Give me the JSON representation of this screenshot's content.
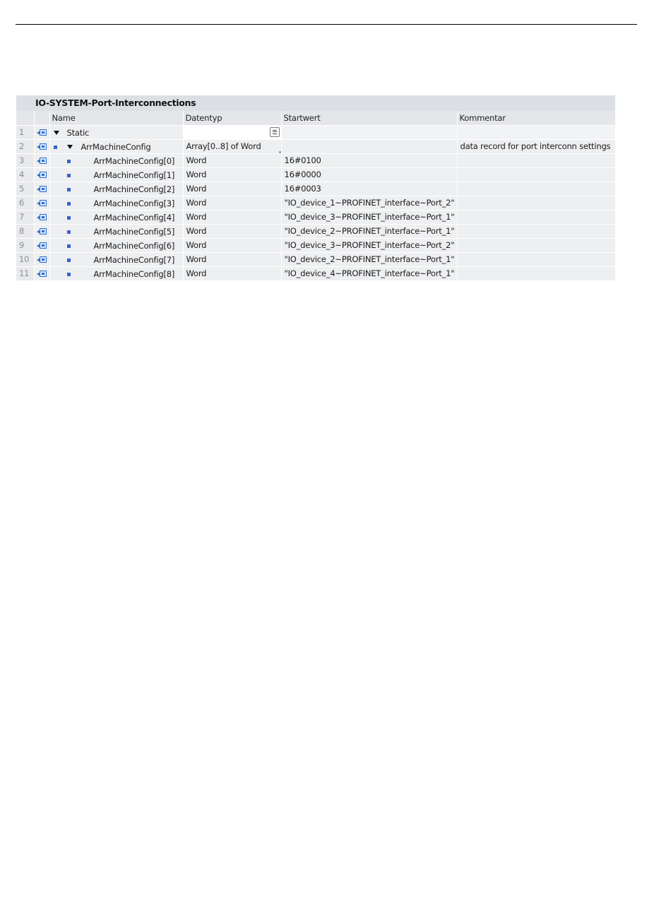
{
  "block": {
    "title": "IO-SYSTEM-Port-Interconnections"
  },
  "columns": {
    "name": "Name",
    "datatype": "Datentyp",
    "start": "Startwert",
    "comment": "Kommentar"
  },
  "rows": [
    {
      "num": "1",
      "name": "Static",
      "datatype": "",
      "start": "",
      "comment": ""
    },
    {
      "num": "2",
      "name": "ArrMachineConfig",
      "datatype": "Array[0..8] of Word",
      "start": "",
      "comment": "data record for port interconn settings"
    },
    {
      "num": "3",
      "name": "ArrMachineConfig[0]",
      "datatype": "Word",
      "start": "16#0100",
      "comment": ""
    },
    {
      "num": "4",
      "name": "ArrMachineConfig[1]",
      "datatype": "Word",
      "start": "16#0000",
      "comment": ""
    },
    {
      "num": "5",
      "name": "ArrMachineConfig[2]",
      "datatype": "Word",
      "start": "16#0003",
      "comment": ""
    },
    {
      "num": "6",
      "name": "ArrMachineConfig[3]",
      "datatype": "Word",
      "start": "\"IO_device_1~PROFINET_interface~Port_2\"",
      "comment": ""
    },
    {
      "num": "7",
      "name": "ArrMachineConfig[4]",
      "datatype": "Word",
      "start": "\"IO_device_3~PROFINET_interface~Port_1\"",
      "comment": ""
    },
    {
      "num": "8",
      "name": "ArrMachineConfig[5]",
      "datatype": "Word",
      "start": "\"IO_device_2~PROFINET_interface~Port_1\"",
      "comment": ""
    },
    {
      "num": "9",
      "name": "ArrMachineConfig[6]",
      "datatype": "Word",
      "start": "\"IO_device_3~PROFINET_interface~Port_2\"",
      "comment": ""
    },
    {
      "num": "10",
      "name": "ArrMachineConfig[7]",
      "datatype": "Word",
      "start": "\"IO_device_2~PROFINET_interface~Port_1\"",
      "comment": ""
    },
    {
      "num": "11",
      "name": "ArrMachineConfig[8]",
      "datatype": "Word",
      "start": "\"IO_device_4~PROFINET_interface~Port_1\"",
      "comment": ""
    }
  ],
  "icons": {
    "row_icon": "db-interface-icon",
    "expand": "triangle-down-icon",
    "element": "blue-square-icon",
    "list": "list-button-icon"
  },
  "colors": {
    "header_bg": "#e4e6e9",
    "title_bg": "#dcdfe3",
    "cell_bg": "#eeeff1",
    "accent_blue": "#3b62c9"
  }
}
